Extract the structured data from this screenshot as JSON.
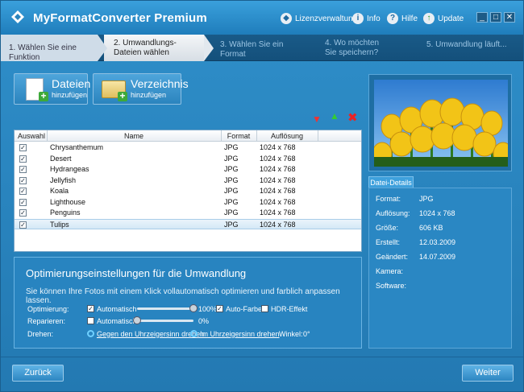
{
  "app": {
    "title": "MyFormatConverter Premium"
  },
  "toolbar": {
    "license": "Lizenzverwaltung",
    "info": "Info",
    "help": "Hilfe",
    "update": "Update"
  },
  "steps": [
    {
      "label": "1. Wählen Sie eine Funktion",
      "state": "done"
    },
    {
      "label": "2. Umwandlungs-Dateien wählen",
      "state": "active"
    },
    {
      "label": "3. Wählen Sie ein Format",
      "state": "pending"
    },
    {
      "label": "4. Wo möchten Sie speichern?",
      "state": "pending"
    },
    {
      "label": "5. Umwandlung läuft...",
      "state": "pending"
    }
  ],
  "buttons": {
    "files": {
      "big": "Dateien",
      "small": "hinzufügen"
    },
    "folder": {
      "big": "Verzeichnis",
      "small": "hinzufügen"
    },
    "back": "Zurück",
    "next": "Weiter"
  },
  "table": {
    "headers": [
      "Auswahl",
      "Name",
      "Format",
      "Auflösung"
    ],
    "rows": [
      {
        "name": "Chrysanthemum",
        "format": "JPG",
        "resolution": "1024 x 768",
        "checked": true,
        "selected": false
      },
      {
        "name": "Desert",
        "format": "JPG",
        "resolution": "1024 x 768",
        "checked": true,
        "selected": false
      },
      {
        "name": "Hydrangeas",
        "format": "JPG",
        "resolution": "1024 x 768",
        "checked": true,
        "selected": false
      },
      {
        "name": "Jellyfish",
        "format": "JPG",
        "resolution": "1024 x 768",
        "checked": true,
        "selected": false
      },
      {
        "name": "Koala",
        "format": "JPG",
        "resolution": "1024 x 768",
        "checked": true,
        "selected": false
      },
      {
        "name": "Lighthouse",
        "format": "JPG",
        "resolution": "1024 x 768",
        "checked": true,
        "selected": false
      },
      {
        "name": "Penguins",
        "format": "JPG",
        "resolution": "1024 x 768",
        "checked": true,
        "selected": false
      },
      {
        "name": "Tulips",
        "format": "JPG",
        "resolution": "1024 x 768",
        "checked": true,
        "selected": true
      }
    ]
  },
  "optimization": {
    "title": "Optimierungseinstellungen für die Umwandlung",
    "description": "Sie können Ihre Fotos mit einem Klick vollautomatisch optimieren und farblich anpassen lassen.",
    "optimize": {
      "label": "Optimierung:",
      "auto": "Automatisch",
      "auto_checked": true,
      "value": "100%",
      "level": 1.0,
      "color": "Auto-Farbe",
      "color_checked": true,
      "hdr": "HDR-Effekt",
      "hdr_checked": false
    },
    "repair": {
      "label": "Reparieren:",
      "auto": "Automatisch",
      "auto_checked": false,
      "value": "0%",
      "level": 0.0
    },
    "rotate": {
      "label": "Drehen:",
      "ccw": "Gegen den Uhrzeigersinn drehen",
      "cw": "Im Uhrzeigersinn drehen",
      "angle_label": "Winkel:",
      "angle": "0°"
    }
  },
  "details": {
    "tab": "Datei-Details",
    "fields": [
      {
        "key": "Format:",
        "value": "JPG"
      },
      {
        "key": "Auflösung:",
        "value": "1024 x 768"
      },
      {
        "key": "Größe:",
        "value": "606 KB"
      },
      {
        "key": "Erstellt:",
        "value": "12.03.2009"
      },
      {
        "key": "Geändert:",
        "value": "14.07.2009"
      },
      {
        "key": "Kamera:",
        "value": ""
      },
      {
        "key": "Software:",
        "value": ""
      }
    ]
  },
  "colors": {
    "accent": "#2a84bd",
    "titlebar": "#1f7dbb",
    "selection": "#d4e8f6"
  }
}
